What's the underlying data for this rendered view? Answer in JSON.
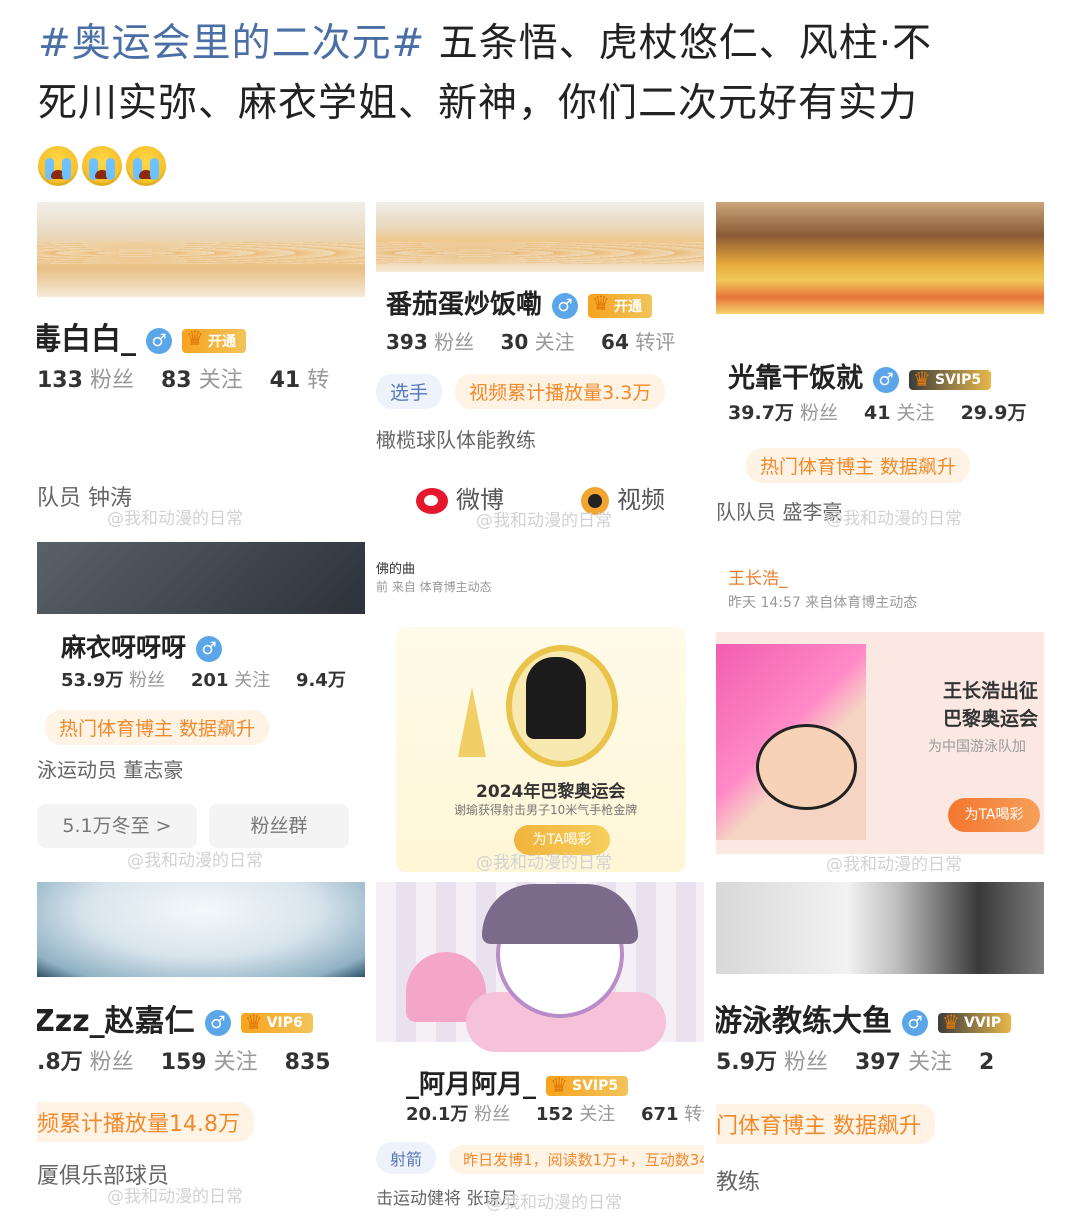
{
  "post": {
    "hashtag": "#奥运会里的二次元#",
    "text_line1": " 五条悟、虎杖悠仁、风柱·不",
    "text_line2": "死川实弥、麻衣学姐、新神，你们二次元好有实力",
    "emoji": "crying-face-emoji"
  },
  "tiles": [
    {
      "name": "毒白白_",
      "vip": "开通",
      "stats": [
        "133",
        "粉丝",
        "83",
        "关注",
        "41",
        "转"
      ],
      "desc": "队员 钟涛",
      "watermark": "@我和动漫的日常"
    },
    {
      "name": "番茄蛋炒饭嘞",
      "vip": "开通",
      "stats": [
        "393",
        "粉丝",
        "30",
        "关注",
        "64",
        "转评"
      ],
      "tags": [
        "选手",
        "视频累计播放量3.3万"
      ],
      "desc": "橄榄球队体能教练",
      "social": [
        "微博",
        "视频"
      ],
      "watermark": "@我和动漫的日常"
    },
    {
      "name": "光靠干饭就",
      "vip": "SVIP5",
      "stats": [
        "39.7万",
        "粉丝",
        "41",
        "关注",
        "29.9万"
      ],
      "tags": [
        "热门体育博主 数据飙升"
      ],
      "desc": "队队员 盛李豪",
      "watermark": "@我和动漫的日常"
    },
    {
      "name": "麻衣呀呀呀",
      "stats": [
        "53.9万",
        "粉丝",
        "201",
        "关注",
        "9.4万"
      ],
      "tags": [
        "热门体育博主 数据飙升"
      ],
      "desc": "泳运动员 董志豪",
      "buttons": [
        "5.1万冬至 >",
        "粉丝群"
      ],
      "watermark": "@我和动漫的日常"
    },
    {
      "header_name": "佛的曲",
      "header_sub": "前 来自 体育博主动态",
      "card_title": "2024年巴黎奥运会",
      "card_sub": "谢瑜获得射击男子10米气手枪金牌",
      "button": "为TA喝彩",
      "watermark": "@我和动漫的日常"
    },
    {
      "header_name": "王长浩_",
      "header_sub": "昨天 14:57  来自体育博主动态",
      "card_title1": "王长浩出征",
      "card_title2": "巴黎奥运会",
      "card_sub": "为中国游泳队加",
      "button": "为TA喝彩",
      "watermark": "@我和动漫的日常"
    },
    {
      "name": "Zzz_赵嘉仁",
      "vip": "VIP6",
      "stats": [
        ".8万",
        "粉丝",
        "159",
        "关注",
        "835"
      ],
      "tags": [
        "频累计播放量14.8万"
      ],
      "desc": "厦俱乐部球员",
      "watermark": "@我和动漫的日常"
    },
    {
      "name": "_阿月阿月_",
      "vip": "SVIP5",
      "stats": [
        "20.1万",
        "粉丝",
        "152",
        "关注",
        "671",
        "转评"
      ],
      "tags": [
        "射箭",
        "昨日发博1，阅读数1万+，互动数34"
      ],
      "desc": "击运动健将 张琼月",
      "watermark": "@我和动漫的日常"
    },
    {
      "name": "游泳教练大鱼",
      "vip": "VVIP",
      "stats": [
        "5.9万",
        "粉丝",
        "397",
        "关注",
        "2"
      ],
      "tags": [
        "门体育博主 数据飙升"
      ],
      "desc": "教练",
      "watermark": ""
    }
  ]
}
